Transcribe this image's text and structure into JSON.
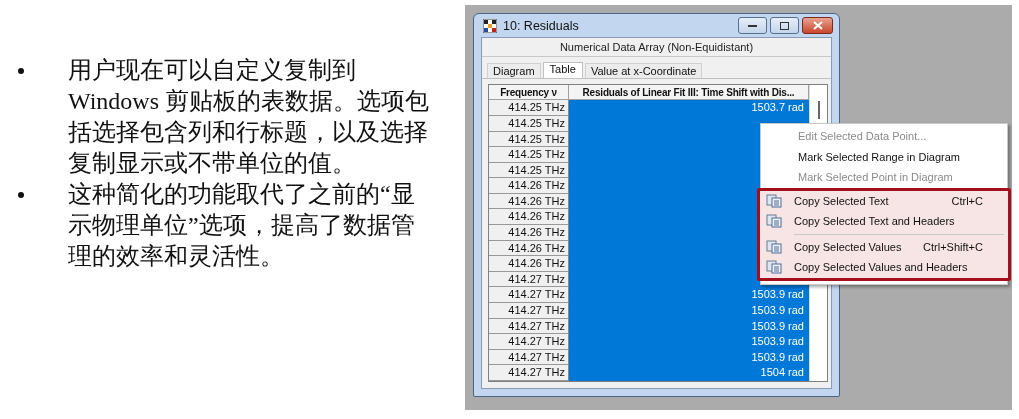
{
  "slide": {
    "bullets": [
      "用户现在可以自定义复制到 Windows 剪贴板的表数据。选项包括选择包含列和行标题，以及选择复制显示或不带单位的值。",
      "这种简化的功能取代了之前的“显示物理单位”选项，提高了数据管理的效率和灵活性。"
    ]
  },
  "window": {
    "title": "10: Residuals",
    "subtitle": "Numerical Data Array (Non-Equidistant)",
    "tabs": [
      {
        "label": "Diagram",
        "selected": false
      },
      {
        "label": "Table",
        "selected": true
      },
      {
        "label": "Value at x-Coordinate",
        "selected": false
      }
    ],
    "table": {
      "columns": [
        "Frequency ν",
        "Residuals of Linear Fit III: Time Shift with Dis..."
      ],
      "rows": [
        {
          "frequency": "414.25 THz",
          "value": "1503.7 rad",
          "selected": true
        },
        {
          "frequency": "414.25 THz",
          "selected": true
        },
        {
          "frequency": "414.25 THz",
          "selected": true
        },
        {
          "frequency": "414.25 THz",
          "selected": true
        },
        {
          "frequency": "414.25 THz",
          "selected": true
        },
        {
          "frequency": "414.26 THz",
          "selected": true
        },
        {
          "frequency": "414.26 THz",
          "selected": true
        },
        {
          "frequency": "414.26 THz",
          "selected": true
        },
        {
          "frequency": "414.26 THz",
          "selected": true
        },
        {
          "frequency": "414.26 THz",
          "selected": true
        },
        {
          "frequency": "414.26 THz",
          "selected": true
        },
        {
          "frequency": "414.27 THz",
          "selected": true
        },
        {
          "frequency": "414.27 THz",
          "value": "1503.9 rad",
          "selected": true
        },
        {
          "frequency": "414.27 THz",
          "value": "1503.9 rad",
          "selected": true
        },
        {
          "frequency": "414.27 THz",
          "value": "1503.9 rad",
          "selected": true
        },
        {
          "frequency": "414.27 THz",
          "value": "1503.9 rad",
          "selected": true
        },
        {
          "frequency": "414.27 THz",
          "value": "1503.9 rad",
          "selected": true
        },
        {
          "frequency": "414.27 THz",
          "value": "1504 rad",
          "selected": true
        }
      ]
    }
  },
  "context_menu": {
    "items": [
      {
        "kind": "command",
        "label": "Edit Selected Data Point...",
        "disabled": true,
        "emphasized": false
      },
      {
        "kind": "command",
        "label": "Mark Selected Range in Diagram",
        "disabled": false,
        "emphasized": false
      },
      {
        "kind": "command",
        "label": "Mark Selected Point in Diagram",
        "disabled": true,
        "emphasized": false
      },
      {
        "kind": "copy",
        "label": "Copy Selected Text",
        "shortcut": "Ctrl+C",
        "disabled": false,
        "emphasized": true
      },
      {
        "kind": "copy",
        "label": "Copy Selected Text and Headers",
        "disabled": false,
        "emphasized": true
      },
      {
        "kind": "separator",
        "emphasized": true
      },
      {
        "kind": "copy",
        "label": "Copy Selected Values",
        "shortcut": "Ctrl+Shift+C",
        "disabled": false,
        "emphasized": true
      },
      {
        "kind": "copy",
        "label": "Copy Selected Values and Headers",
        "disabled": false,
        "emphasized": true
      }
    ]
  }
}
